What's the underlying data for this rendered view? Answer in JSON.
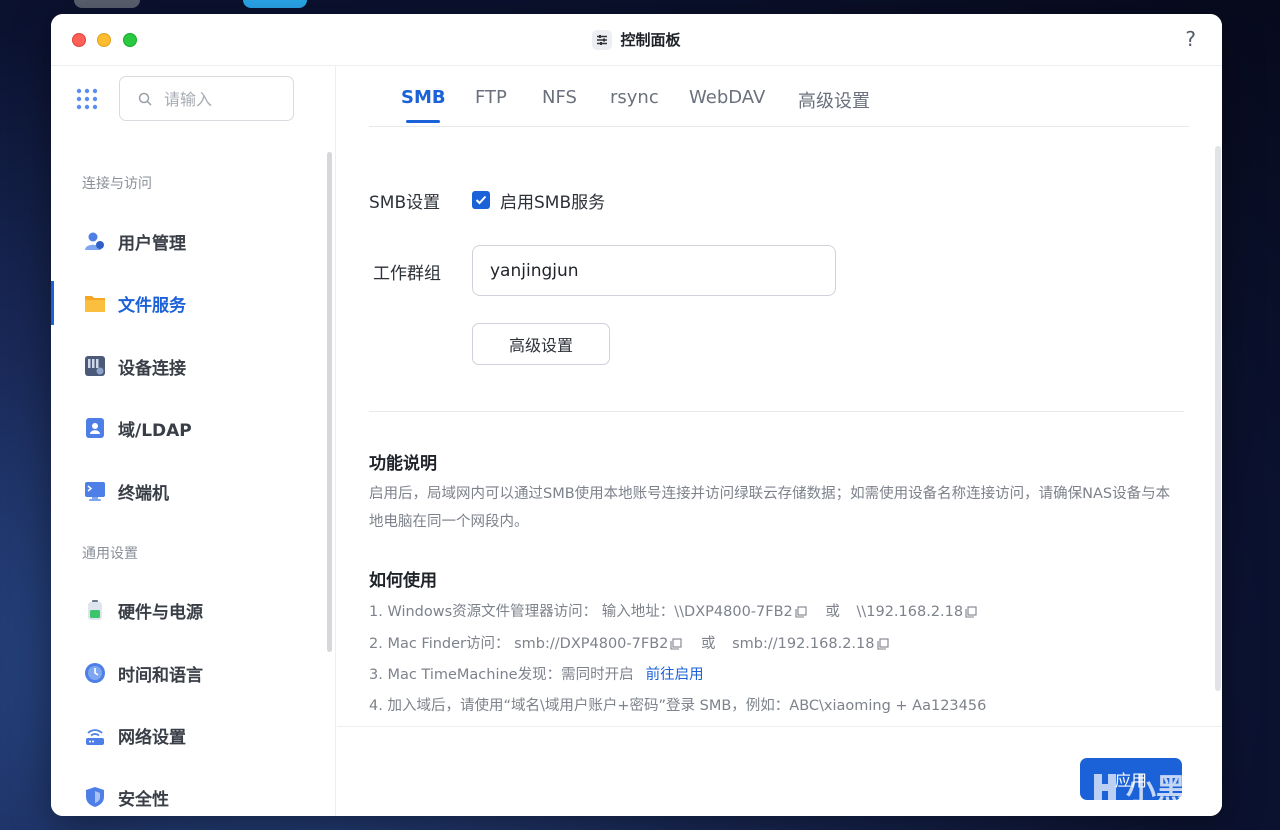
{
  "window": {
    "title": "控制面板",
    "help": "?"
  },
  "sidebar": {
    "search_placeholder": "请输入",
    "groups": [
      {
        "label": "连接与访问"
      },
      {
        "label": "通用设置"
      }
    ],
    "items": [
      {
        "label": "用户管理",
        "icon": "user-management-icon"
      },
      {
        "label": "文件服务",
        "icon": "folder-icon",
        "active": true
      },
      {
        "label": "设备连接",
        "icon": "device-connection-icon"
      },
      {
        "label": "域/LDAP",
        "icon": "ldap-icon"
      },
      {
        "label": "终端机",
        "icon": "terminal-icon"
      },
      {
        "label": "硬件与电源",
        "icon": "battery-icon"
      },
      {
        "label": "时间和语言",
        "icon": "clock-icon"
      },
      {
        "label": "网络设置",
        "icon": "router-icon"
      },
      {
        "label": "安全性",
        "icon": "shield-icon"
      }
    ]
  },
  "tabs": [
    {
      "label": "SMB",
      "active": true
    },
    {
      "label": "FTP"
    },
    {
      "label": "NFS"
    },
    {
      "label": "rsync"
    },
    {
      "label": "WebDAV"
    },
    {
      "label": "高级设置"
    }
  ],
  "smb": {
    "settings_label": "SMB设置",
    "enable_label": "启用SMB服务",
    "enabled": true,
    "workgroup_label": "工作群组",
    "workgroup_value": "yanjingjun",
    "advanced_button": "高级设置"
  },
  "function_desc": {
    "title": "功能说明",
    "text": "启用后，局域网内可以通过SMB使用本地账号连接并访问绿联云存储数据；如需使用设备名称连接访问，请确保NAS设备与本地电脑在同一个网段内。"
  },
  "how_to_use": {
    "title": "如何使用",
    "step1": {
      "prefix": "1. Windows资源文件管理器访问：  输入地址：\\\\DXP4800-7FB2",
      "or": "或",
      "addr2": "\\\\192.168.2.18"
    },
    "step2": {
      "prefix": "2. Mac Finder访问：  smb://DXP4800-7FB2",
      "or": "或",
      "addr2": "smb://192.168.2.18"
    },
    "step3": {
      "text": "3. Mac TimeMachine发现：需同时开启",
      "link": "前往启用"
    },
    "step4": {
      "text": "4. 加入域后，请使用“域名\\域用户账户+密码”登录 SMB，例如：ABC\\xiaoming + Aa123456"
    }
  },
  "footer": {
    "apply_button": "应用"
  },
  "watermark": {
    "text": "小黑盒"
  },
  "colors": {
    "accent": "#1b62d8",
    "text": "#2d3138",
    "muted": "#7d828b"
  }
}
